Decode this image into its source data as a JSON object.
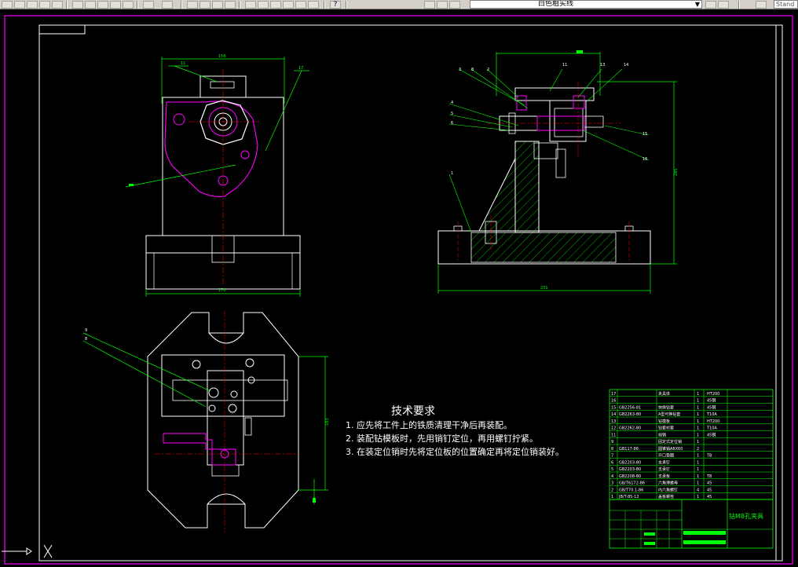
{
  "toolbar": {
    "layer_name": "白色粗实线",
    "text_style": "Stand",
    "help_label": "?"
  },
  "drawing": {
    "tech_title": "技术要求",
    "tech_notes": [
      "1. 应先将工件上的铁质清理干净后再装配。",
      "2. 装配钻模板时，先用销钉定位，再用螺钉拧紧。",
      "3. 在装定位销时先将定位板的位置确定再将定位销装好。"
    ],
    "title_block_name": "钻M8孔夹具",
    "dimensions": {
      "front_top": "156",
      "front_bottom": "170",
      "side_bottom": "231",
      "side_height": "285",
      "top_height": "183"
    },
    "balloons_side": [
      "3",
      "8",
      "2",
      "11",
      "13",
      "14",
      "4",
      "5",
      "6",
      "1",
      "15",
      "16"
    ],
    "balloon_front_top": "11",
    "balloon_front_right": "17",
    "balloons_top": [
      "9",
      "8"
    ],
    "bom_rows": [
      {
        "no": "17",
        "std": "",
        "name": "夹具体",
        "qty": "1",
        "mat": "HT200"
      },
      {
        "no": "16",
        "std": "",
        "name": "",
        "qty": "1",
        "mat": "45钢"
      },
      {
        "no": "15",
        "std": "GB2256-81",
        "name": "快换钻套",
        "qty": "1",
        "mat": "45钢"
      },
      {
        "no": "14",
        "std": "GB2263-80",
        "name": "A型可换钻套",
        "qty": "1",
        "mat": "T10A"
      },
      {
        "no": "13",
        "std": "",
        "name": "钻模板",
        "qty": "1",
        "mat": "HT200"
      },
      {
        "no": "12",
        "std": "GB2262-80",
        "name": "钻套衬套",
        "qty": "1",
        "mat": "T10A"
      },
      {
        "no": "11",
        "std": "",
        "name": "挡销",
        "qty": "1",
        "mat": "45钢"
      },
      {
        "no": "9",
        "std": "",
        "name": "固定式定位销",
        "qty": "1",
        "mat": ""
      },
      {
        "no": "8",
        "std": "GB117-86",
        "name": "圆锥销A8X60",
        "qty": "2",
        "mat": ""
      },
      {
        "no": "7",
        "std": "",
        "name": "开口垫圈",
        "qty": "1",
        "mat": "T8"
      },
      {
        "no": "6",
        "std": "GB2203-80",
        "name": "支承钉",
        "qty": "1",
        "mat": ""
      },
      {
        "no": "5",
        "std": "GB2203-80",
        "name": "支承钉",
        "qty": "1",
        "mat": ""
      },
      {
        "no": "4",
        "std": "GB2208-80",
        "name": "支承板",
        "qty": "1",
        "mat": "T8"
      },
      {
        "no": "3",
        "std": "GB/T6172-86",
        "name": "六角薄螺母",
        "qty": "1",
        "mat": "45"
      },
      {
        "no": "2",
        "std": "GB/T70.1-86",
        "name": "内六角螺钉",
        "qty": "4",
        "mat": "45"
      },
      {
        "no": "1",
        "std": "JB/T-85-12",
        "name": "盖板螺栓",
        "qty": "1",
        "mat": "45"
      }
    ]
  },
  "colors": {
    "background": "#000000",
    "frame": "#ff00ff",
    "outline": "#ffffff",
    "dimension": "#00ff00",
    "center": "#ff0000",
    "part": "#ff00ff",
    "hatch": "#00ff00",
    "note_text": "#ffffff",
    "title_text": "#00ff00"
  },
  "icons": [
    "ucs-icon",
    "layer-state-icons",
    "zoom-icons",
    "help-icon"
  ]
}
